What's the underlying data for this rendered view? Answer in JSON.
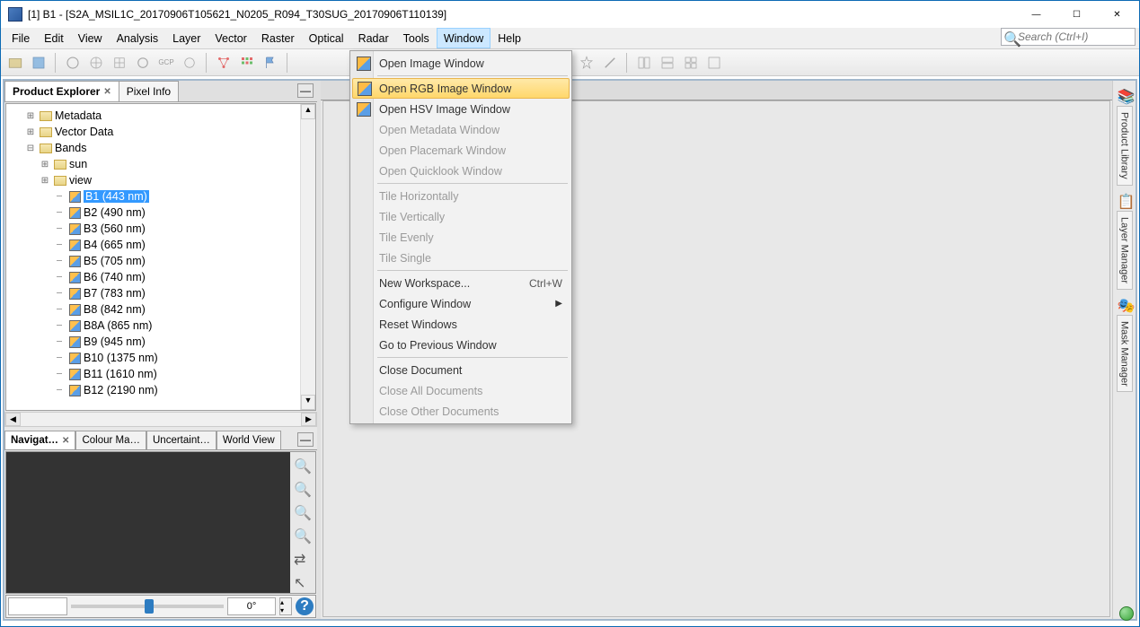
{
  "title": "[1] B1 - [S2A_MSIL1C_20170906T105621_N0205_R094_T30SUG_20170906T110139]",
  "window_controls": {
    "min": "—",
    "max": "☐",
    "close": "✕"
  },
  "menubar": [
    "File",
    "Edit",
    "View",
    "Analysis",
    "Layer",
    "Vector",
    "Raster",
    "Optical",
    "Radar",
    "Tools",
    "Window",
    "Help"
  ],
  "active_menu_index": 10,
  "search_placeholder": "Search (Ctrl+I)",
  "panel_tabs": {
    "active": "Product Explorer",
    "other": "Pixel Info"
  },
  "tree": {
    "metadata": "Metadata",
    "vector": "Vector Data",
    "bands_label": "Bands",
    "folders": [
      "sun",
      "view"
    ],
    "bands": [
      "B1 (443 nm)",
      "B2 (490 nm)",
      "B3 (560 nm)",
      "B4 (665 nm)",
      "B5 (705 nm)",
      "B6 (740 nm)",
      "B7 (783 nm)",
      "B8 (842 nm)",
      "B8A (865 nm)",
      "B9 (945 nm)",
      "B10 (1375 nm)",
      "B11 (1610 nm)",
      "B12 (2190 nm)"
    ],
    "selected_band_index": 0
  },
  "bottom_tabs": [
    "Navigat…",
    "Colour Ma…",
    "Uncertaint…",
    "World View"
  ],
  "nav_footer": {
    "angle": "0°"
  },
  "right_tabs": [
    "Product Library",
    "Layer Manager",
    "Mask Manager"
  ],
  "dropdown": {
    "groups": [
      [
        {
          "label": "Open Image Window",
          "icon": true
        }
      ],
      [
        {
          "label": "Open RGB Image Window",
          "icon": true,
          "highlight": true
        },
        {
          "label": "Open HSV Image Window",
          "icon": true
        },
        {
          "label": "Open Metadata Window",
          "disabled": true
        },
        {
          "label": "Open Placemark Window",
          "disabled": true
        },
        {
          "label": "Open Quicklook Window",
          "disabled": true
        }
      ],
      [
        {
          "label": "Tile Horizontally",
          "disabled": true
        },
        {
          "label": "Tile Vertically",
          "disabled": true
        },
        {
          "label": "Tile Evenly",
          "disabled": true
        },
        {
          "label": "Tile Single",
          "disabled": true
        }
      ],
      [
        {
          "label": "New Workspace...",
          "shortcut": "Ctrl+W"
        },
        {
          "label": "Configure Window",
          "submenu": true
        },
        {
          "label": "Reset Windows"
        },
        {
          "label": "Go to Previous Window"
        }
      ],
      [
        {
          "label": "Close Document"
        },
        {
          "label": "Close All Documents",
          "disabled": true
        },
        {
          "label": "Close Other Documents",
          "disabled": true
        }
      ]
    ]
  }
}
